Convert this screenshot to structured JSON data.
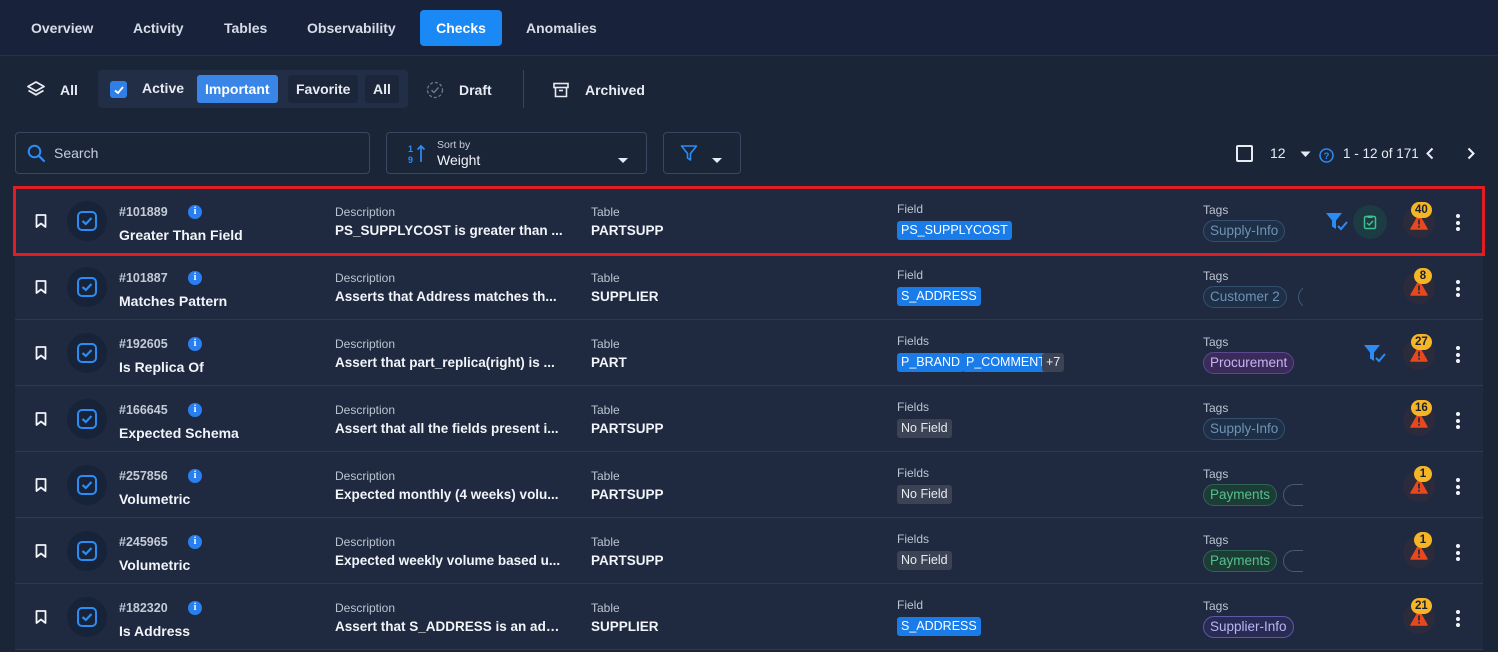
{
  "tabs": [
    {
      "label": "Overview",
      "active": false
    },
    {
      "label": "Activity",
      "active": false
    },
    {
      "label": "Tables",
      "active": false
    },
    {
      "label": "Observability",
      "active": false
    },
    {
      "label": "Checks",
      "active": true
    },
    {
      "label": "Anomalies",
      "active": false
    }
  ],
  "filters": {
    "all": "All",
    "active": "Active",
    "important": "Important",
    "favorite": "Favorite",
    "sub_all": "All",
    "draft": "Draft",
    "archived": "Archived"
  },
  "search": {
    "placeholder": "Search"
  },
  "sort": {
    "label": "Sort by",
    "value": "Weight"
  },
  "pagination": {
    "page_size": "12",
    "range": "1 - 12 of 171"
  },
  "labels": {
    "description": "Description",
    "table": "Table",
    "field": "Field",
    "fields": "Fields",
    "tags": "Tags"
  },
  "colors": {
    "accent": "#1a88f5",
    "highlight": "#e11d24",
    "badge": "#f5b525",
    "alert": "#e8481d"
  },
  "rows": [
    {
      "id": "#101889",
      "name": "Greater Than Field",
      "description": "PS_SUPPLYCOST is greater than ...",
      "table": "PARTSUPP",
      "field_label": "Field",
      "fields": [
        "PS_SUPPLYCOST"
      ],
      "more": "",
      "tags": [
        "Supply-Info"
      ],
      "anomalies": "40",
      "highlighted": true
    },
    {
      "id": "#101887",
      "name": "Matches Pattern",
      "description": "Asserts that Address matches th...",
      "table": "SUPPLIER",
      "field_label": "Field",
      "fields": [
        "S_ADDRESS"
      ],
      "more": "",
      "tags": [
        "Customer 2"
      ],
      "anomalies": "8",
      "highlighted": false
    },
    {
      "id": "#192605",
      "name": "Is Replica Of",
      "description": "Assert that part_replica(right) is ...",
      "table": "PART",
      "field_label": "Fields",
      "fields": [
        "P_BRAND",
        "P_COMMENT"
      ],
      "more": "+7",
      "tags": [
        "Procurement"
      ],
      "anomalies": "27",
      "highlighted": false
    },
    {
      "id": "#166645",
      "name": "Expected Schema",
      "description": "Assert that all the fields present i...",
      "table": "PARTSUPP",
      "field_label": "Fields",
      "fields": [
        "No Field"
      ],
      "more": "",
      "tags": [
        "Supply-Info"
      ],
      "anomalies": "16",
      "highlighted": false
    },
    {
      "id": "#257856",
      "name": "Volumetric",
      "description": "Expected monthly (4 weeks) volu...",
      "table": "PARTSUPP",
      "field_label": "Fields",
      "fields": [
        "No Field"
      ],
      "more": "",
      "tags": [
        "Payments"
      ],
      "anomalies": "1",
      "highlighted": false
    },
    {
      "id": "#245965",
      "name": "Volumetric",
      "description": "Expected weekly volume based u...",
      "table": "PARTSUPP",
      "field_label": "Fields",
      "fields": [
        "No Field"
      ],
      "more": "",
      "tags": [
        "Payments"
      ],
      "anomalies": "1",
      "highlighted": false
    },
    {
      "id": "#182320",
      "name": "Is Address",
      "description": "Assert that S_ADDRESS is an add...",
      "table": "SUPPLIER",
      "field_label": "Field",
      "fields": [
        "S_ADDRESS"
      ],
      "more": "",
      "tags": [
        "Supplier-Info"
      ],
      "anomalies": "21",
      "highlighted": false
    }
  ]
}
